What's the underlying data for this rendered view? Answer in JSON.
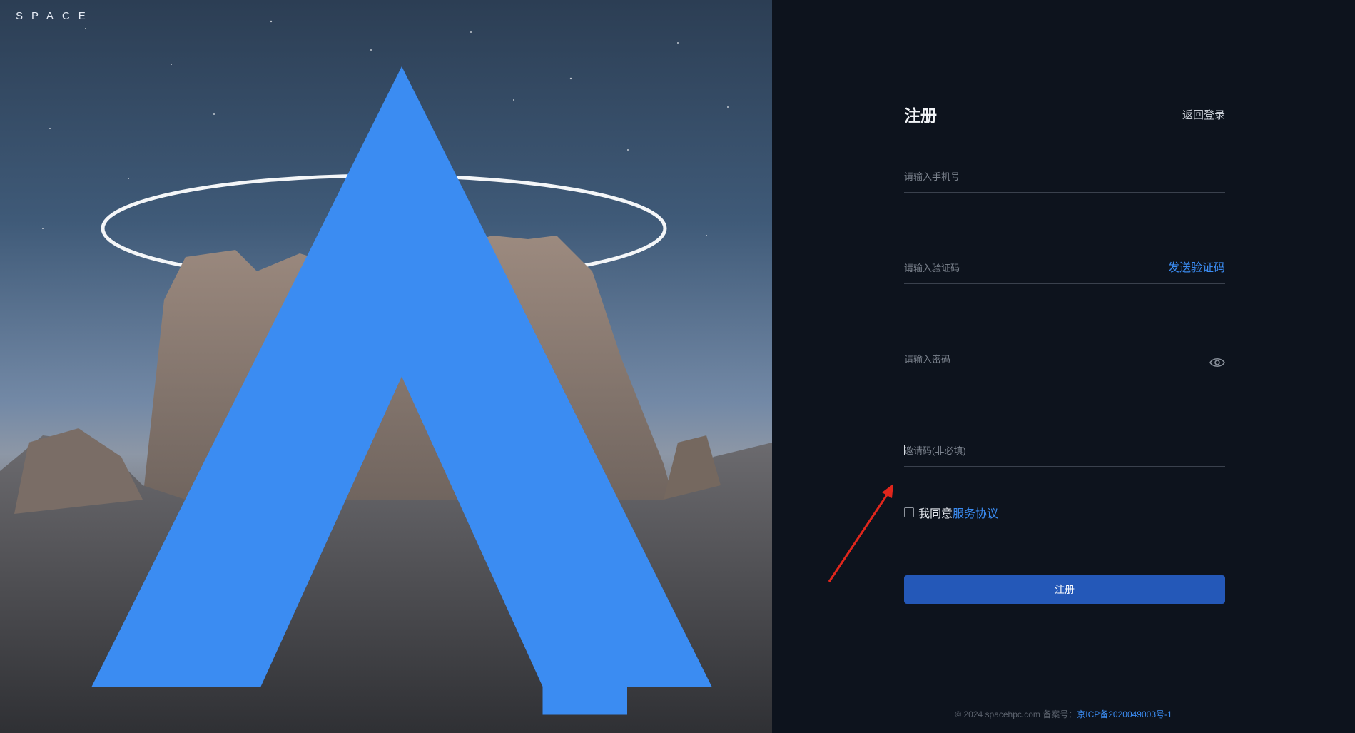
{
  "brand": {
    "name": "SPACE",
    "accent": "#3b8cf2"
  },
  "register": {
    "title": "注册",
    "back_label": "返回登录",
    "phone_placeholder": "请输入手机号",
    "code_placeholder": "请输入验证码",
    "send_code_label": "发送验证码",
    "password_placeholder": "请输入密码",
    "invite_placeholder": "邀请码(非必填)",
    "agree_text": "我同意",
    "agree_link": "服务协议",
    "submit_label": "注册",
    "submit_color": "#2458b8"
  },
  "footer": {
    "copyright": "© 2024 spacehpc.com 备案号：",
    "icp": "京ICP备2020049003号-1"
  },
  "icons": {
    "logo": "space-logo-icon",
    "password_toggle": "eye-icon",
    "annotation": "red-arrow-icon"
  }
}
